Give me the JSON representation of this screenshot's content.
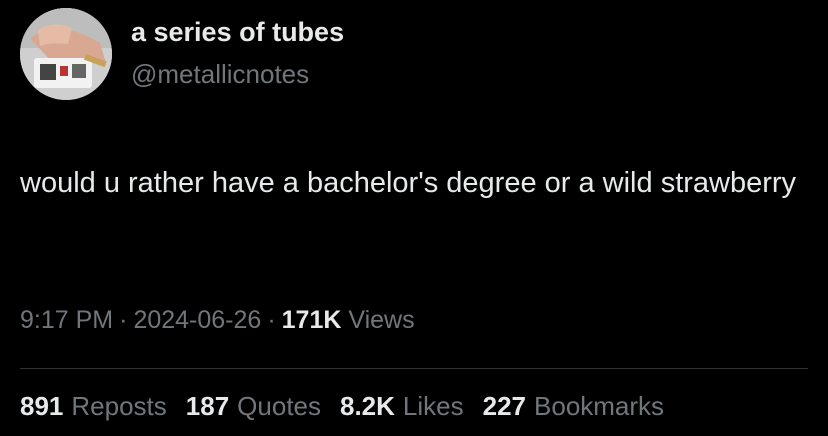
{
  "author": {
    "display_name": "a series of tubes",
    "handle": "@metallicnotes"
  },
  "tweet": {
    "text": "would u rather have a bachelor's degree or a wild strawberry"
  },
  "meta": {
    "time": "9:17 PM",
    "date": "2024-06-26",
    "separator": "·",
    "views_count": "171K",
    "views_label": "Views"
  },
  "stats": {
    "reposts": {
      "count": "891",
      "label": "Reposts"
    },
    "quotes": {
      "count": "187",
      "label": "Quotes"
    },
    "likes": {
      "count": "8.2K",
      "label": "Likes"
    },
    "bookmarks": {
      "count": "227",
      "label": "Bookmarks"
    }
  },
  "colors": {
    "background": "#000000",
    "primary_text": "#e7e9ea",
    "secondary_text": "#71767b",
    "divider": "#2f3336"
  }
}
